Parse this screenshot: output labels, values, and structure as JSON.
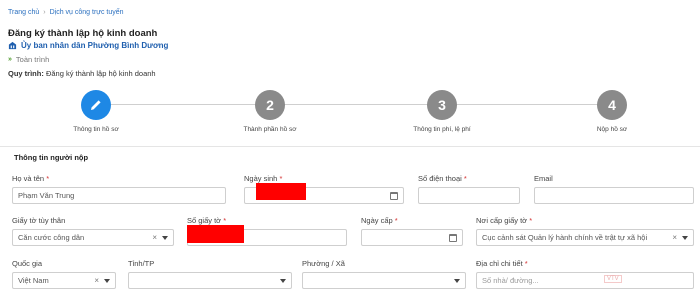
{
  "breadcrumb": [
    "Trang chủ",
    "Dịch vụ công trực tuyến"
  ],
  "page": {
    "title": "Đăng ký thành lập hộ kinh doanh",
    "agency": "Ủy ban nhân dân Phường Bình Dương",
    "scope": "Toàn trình",
    "process_label": "Quy trình:",
    "process_value": "Đăng ký thành lập hộ kinh doanh"
  },
  "steps": [
    {
      "number": "",
      "label": "Thông tin hồ sơ",
      "active": true
    },
    {
      "number": "2",
      "label": "Thành phần hồ sơ",
      "active": false
    },
    {
      "number": "3",
      "label": "Thông tin phí, lệ phí",
      "active": false
    },
    {
      "number": "4",
      "label": "Nộp hồ sơ",
      "active": false
    }
  ],
  "section_title": "Thông tin người nộp",
  "form": {
    "ho_ten": {
      "label": "Họ và tên",
      "value": "Phạm Văn Trung"
    },
    "ngay_sinh": {
      "label": "Ngày sinh",
      "value": ""
    },
    "so_dien_thoai": {
      "label": "Số điện thoại",
      "value": ""
    },
    "email": {
      "label": "Email",
      "value": ""
    },
    "giay_to": {
      "label": "Giấy tờ tùy thân",
      "value": "Căn cước công dân"
    },
    "so_giay_to": {
      "label": "Số giấy tờ",
      "value": ""
    },
    "ngay_cap": {
      "label": "Ngày cấp",
      "value": ""
    },
    "noi_cap": {
      "label": "Nơi cấp giấy tờ",
      "value": "Cục cảnh sát Quản lý hành chính về trật tự xã hội"
    },
    "quoc_gia": {
      "label": "Quốc gia",
      "value": "Việt Nam"
    },
    "tinh_tp": {
      "label": "Tỉnh/TP",
      "value": ""
    },
    "phuong_xa": {
      "label": "Phường / Xã",
      "value": ""
    },
    "dia_chi": {
      "label": "Địa chỉ chi tiết",
      "placeholder": "Số nhà/ đường..."
    }
  },
  "required_mark": "*",
  "watermark": "VTV",
  "colors": {
    "primary": "#1e88e5",
    "inactive_step": "#8a8a8a",
    "required": "#d32f2f",
    "redaction": "#ff0000"
  }
}
